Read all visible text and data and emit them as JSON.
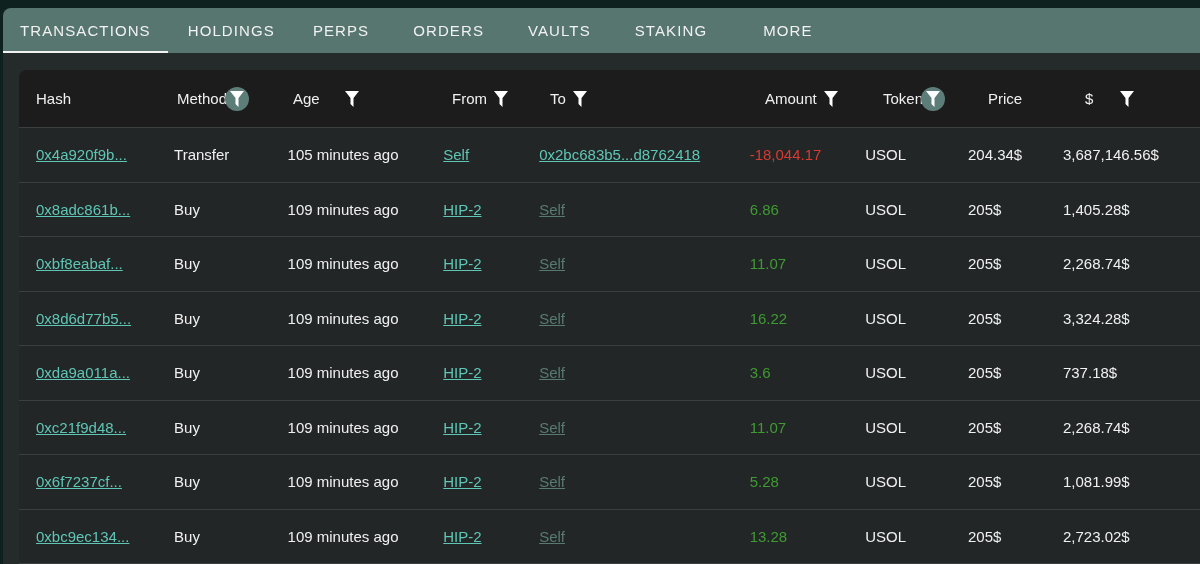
{
  "tabs": [
    {
      "label": "TRANSACTIONS",
      "selected": true
    },
    {
      "label": "HOLDINGS",
      "selected": false
    },
    {
      "label": "PERPS",
      "selected": false
    },
    {
      "label": "ORDERS",
      "selected": false
    },
    {
      "label": "VAULTS",
      "selected": false
    },
    {
      "label": "STAKING",
      "selected": false
    },
    {
      "label": "MORE",
      "selected": false
    }
  ],
  "table": {
    "columns": [
      {
        "label": "Hash",
        "kind": "plain"
      },
      {
        "label": "Method",
        "kind": "filtered"
      },
      {
        "label": "Age",
        "kind": "filterable"
      },
      {
        "label": "From",
        "kind": "filterable"
      },
      {
        "label": "To",
        "kind": "filterable"
      },
      {
        "label": "Amount",
        "kind": "filterable"
      },
      {
        "label": "Token",
        "kind": "filtered"
      },
      {
        "label": "Price",
        "kind": "plain"
      },
      {
        "label": "$",
        "kind": "filterable"
      }
    ],
    "rows": [
      {
        "hash": "0x4a920f9b...",
        "method": "Transfer",
        "age": "105 minutes ago",
        "from": "Self",
        "to": "0x2bc683b5...d8762418",
        "to_dimmed": false,
        "amount": "-18,044.17",
        "kind": "out",
        "token": "USOL",
        "price": "204.34$",
        "value": "3,687,146.56$"
      },
      {
        "hash": "0x8adc861b...",
        "method": "Buy",
        "age": "109 minutes ago",
        "from": "HIP-2",
        "to": "Self",
        "to_dimmed": true,
        "amount": "6.86",
        "kind": "in",
        "token": "USOL",
        "price": "205$",
        "value": "1,405.28$"
      },
      {
        "hash": "0xbf8eabaf...",
        "method": "Buy",
        "age": "109 minutes ago",
        "from": "HIP-2",
        "to": "Self",
        "to_dimmed": true,
        "amount": "11.07",
        "kind": "in",
        "token": "USOL",
        "price": "205$",
        "value": "2,268.74$"
      },
      {
        "hash": "0x8d6d77b5...",
        "method": "Buy",
        "age": "109 minutes ago",
        "from": "HIP-2",
        "to": "Self",
        "to_dimmed": true,
        "amount": "16.22",
        "kind": "in",
        "token": "USOL",
        "price": "205$",
        "value": "3,324.28$"
      },
      {
        "hash": "0xda9a011a...",
        "method": "Buy",
        "age": "109 minutes ago",
        "from": "HIP-2",
        "to": "Self",
        "to_dimmed": true,
        "amount": "3.6",
        "kind": "in",
        "token": "USOL",
        "price": "205$",
        "value": "737.18$"
      },
      {
        "hash": "0xc21f9d48...",
        "method": "Buy",
        "age": "109 minutes ago",
        "from": "HIP-2",
        "to": "Self",
        "to_dimmed": true,
        "amount": "11.07",
        "kind": "in",
        "token": "USOL",
        "price": "205$",
        "value": "2,268.74$"
      },
      {
        "hash": "0x6f7237cf...",
        "method": "Buy",
        "age": "109 minutes ago",
        "from": "HIP-2",
        "to": "Self",
        "to_dimmed": true,
        "amount": "5.28",
        "kind": "in",
        "token": "USOL",
        "price": "205$",
        "value": "1,081.99$"
      },
      {
        "hash": "0xbc9ec134...",
        "method": "Buy",
        "age": "109 minutes ago",
        "from": "HIP-2",
        "to": "Self",
        "to_dimmed": true,
        "amount": "13.28",
        "kind": "in",
        "token": "USOL",
        "price": "205$",
        "value": "2,723.02$"
      }
    ]
  }
}
